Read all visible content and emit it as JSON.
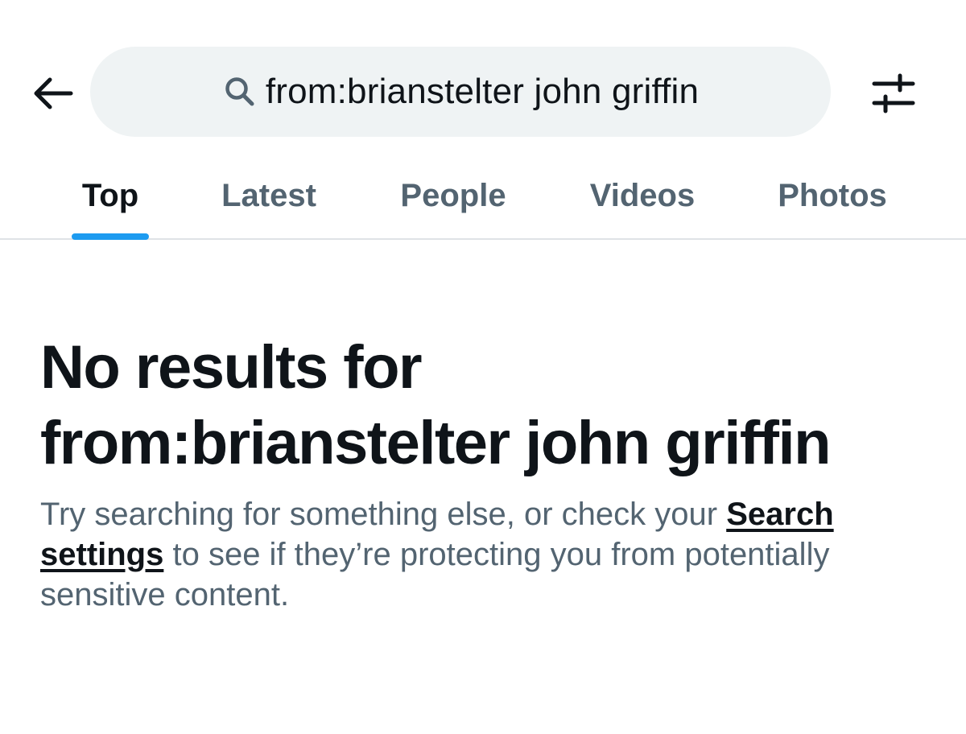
{
  "header": {
    "back_icon": "arrow-left-icon",
    "search_icon": "search-icon",
    "search_query": "from:brianstelter john griffin",
    "filter_icon": "sliders-icon"
  },
  "tabs": [
    {
      "label": "Top",
      "active": true
    },
    {
      "label": "Latest",
      "active": false
    },
    {
      "label": "People",
      "active": false
    },
    {
      "label": "Videos",
      "active": false
    },
    {
      "label": "Photos",
      "active": false
    }
  ],
  "empty_state": {
    "title_line1": "No results for",
    "title_line2": "from:brianstelter john griffin",
    "desc_prefix": "Try searching for something else, or check your ",
    "desc_link": "Search settings",
    "desc_suffix": " to see if they’re protecting you from potentially sensitive content."
  },
  "colors": {
    "accent": "#1d9bf0",
    "text_primary": "#0f1419",
    "text_secondary": "#536471",
    "search_bg": "#eff3f4"
  }
}
